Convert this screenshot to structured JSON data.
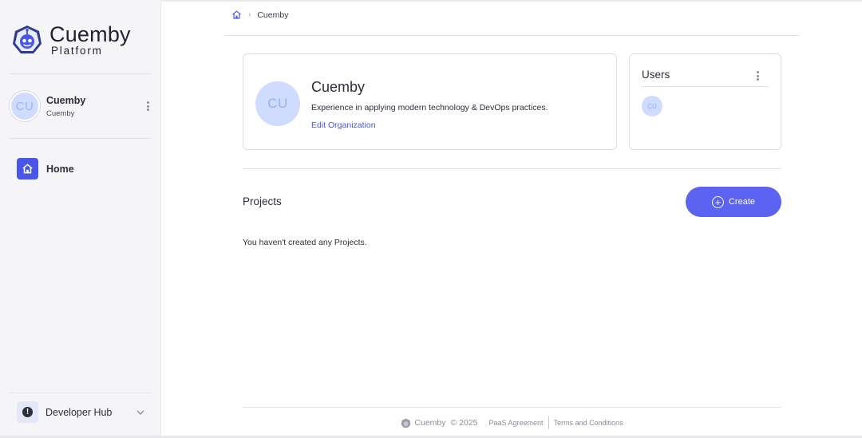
{
  "brand": {
    "name": "Cuemby",
    "subtitle": "Platform",
    "logo_icon": "cuemby-robot-icon",
    "accent": "#4a56e8"
  },
  "sidebar": {
    "org": {
      "initials": "CU",
      "name": "Cuemby",
      "sub": "Cuemby"
    },
    "nav": [
      {
        "label": "Home",
        "icon": "home-icon",
        "active": true
      }
    ],
    "devhub": {
      "label": "Developer Hub",
      "icon": "alert-icon"
    }
  },
  "breadcrumb": {
    "items": [
      "Cuemby"
    ]
  },
  "org_card": {
    "initials": "CU",
    "name": "Cuemby",
    "description": "Experience in applying modern technology & DevOps practices.",
    "edit_label": "Edit Organization"
  },
  "users_card": {
    "title": "Users",
    "avatars": [
      "CU"
    ]
  },
  "projects": {
    "title": "Projects",
    "create_label": "Create",
    "empty_message": "You haven't created any Projects."
  },
  "footer": {
    "brand": "Cuemby",
    "copyright": "© 2025",
    "links": [
      "PaaS Agreement",
      "Terms and Conditions"
    ]
  }
}
